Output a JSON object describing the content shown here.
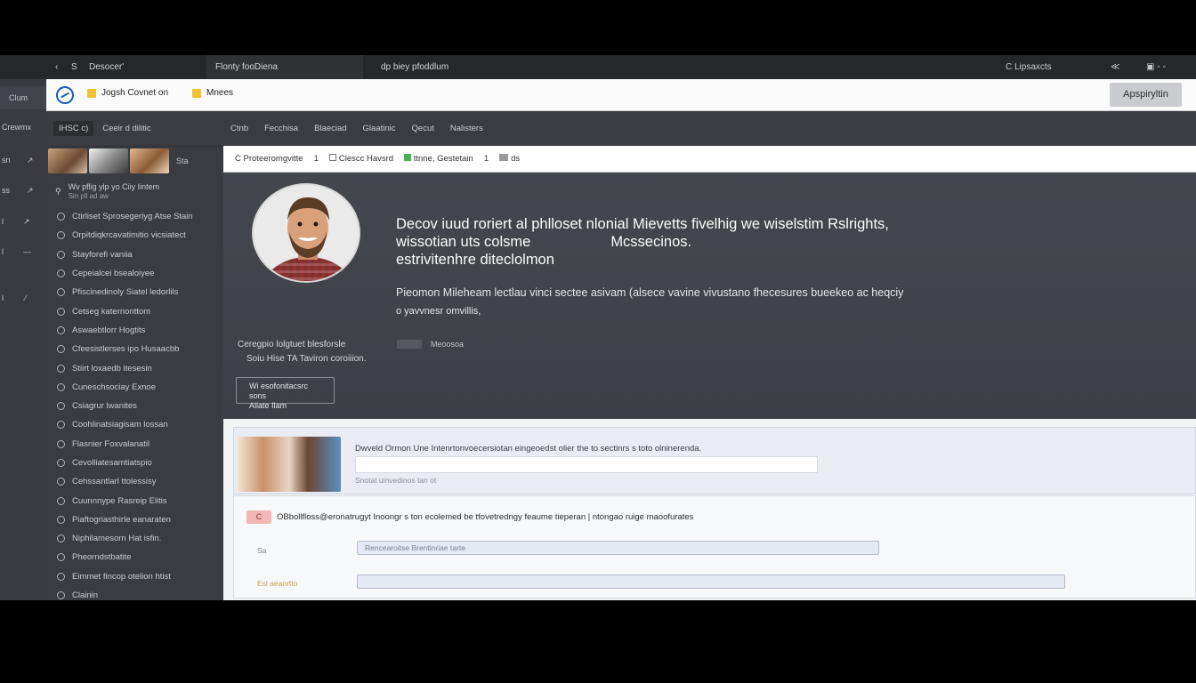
{
  "tabs": {
    "nav_back": "‹",
    "nav_count": "S",
    "tab1": "Desocer'",
    "tab2": "Flonty fooDiena",
    "tab3": "dp biey pfoddlum",
    "right_label": "C Lipsaxcts",
    "right_icon": "≪",
    "win_icon": "▣ ◦ ◦"
  },
  "rail": {
    "top": "Clum",
    "items": [
      "Crewmx",
      "sn",
      "ss",
      "l",
      "l",
      "",
      "l"
    ],
    "arrows": [
      "⁄",
      "↗",
      "↗",
      "↗",
      "—",
      "",
      "⁄"
    ]
  },
  "appbar": {
    "crumb1": "Jogsh Covnet on",
    "crumb2": "Mnees",
    "action": "Apspiryltin"
  },
  "sidebar": {
    "header_pill": "IHSC  c)",
    "header_label": "Ceeir d dilitic",
    "thumb_caption": "Sta",
    "search_text": "Wv pflig ylp yo  Ciiy Iintem",
    "search_sub": "Sin pll  ad aw",
    "items": [
      "Ctirliset Sprosegeriyg Atse Stain",
      "Orpitdiqkrcavatimitio vicsiatect",
      "Stayforefi vaniia",
      "Cepeialcei bsealoiyee",
      "Pfiscinedinoly Siatel ledorlils",
      "Cetseg katernonttom",
      "Aswaebtlorr Hogtits",
      "Cfeesistlerses ipo Husaacbb",
      "Stiirt loxaedb itesesin",
      "Cuneschsociay Exnoe",
      "Csiagrur lwanites",
      "Coohlinatsiagisam lossan",
      "Flasnier Foxvalanatil",
      "Cevolliatesamtiatspio",
      "Cehssantlarl ttolessisy",
      "Cuunnnype Rasreip Elitis",
      "Piaftogriasthirle eanaraten",
      "Niphilamesorn Hat isfin.",
      "Pheorndstbatite",
      "Eimmet fincop otelion  htist",
      "Clainin"
    ]
  },
  "main": {
    "tabs": [
      "Ctnb",
      "Fecchisa",
      "Blaeciad",
      "Glaatinic",
      "Qecut",
      "Nalisters"
    ],
    "crumbs": [
      "C Proteeromgvitte",
      "1",
      "Clescc Havsrd",
      "ttnne, Gestetain",
      "1",
      "ds"
    ],
    "hero_title_1": "Decov iuud roriert al phlloset nlonial Mievetts fivelhig  we wiselstim Rslrights,",
    "hero_title_2": "wissotian uts colsme",
    "hero_title_2b": "Mcssecinos.",
    "hero_title_3": "estrivitenhre diteclolmon",
    "hero_body_1": "Pieomon Mileheam lectlau vinci sectee asivam (alsece vavine vivustano fhecesures bueekeo ac heqciy",
    "hero_body_2": "o yavvnesr omvillis,",
    "meta_1": "Ceregpio lolgtuet blesforsle",
    "meta_2": "Soiu Hise TA Taviron coroiiion.",
    "meta_side": "Meoosoa",
    "button_1": "Wi esofonitacsrc sons",
    "button_2": "Aliate  Ilam",
    "card1_text": "Dwveld Ormon Une Intenrtonvoecersiotan eingeoedst  olier  the to sectinrs s toto olninerenda.",
    "card1_sub": "Snotat uinvedinos tan ot",
    "card2_badge": "C",
    "card2_headline": "OBbollfloss@eronatrugyt  Inoongr s ton ecolemed be tfovetredngy feaume  tieperan |  ntongao ruige  maoofurates",
    "card2_label1": "Sa",
    "card2_label2": "Esl  aeanrtto",
    "card2_field1": "Rencearoitse  Brentinriae tarte",
    "card2_field2": ""
  }
}
